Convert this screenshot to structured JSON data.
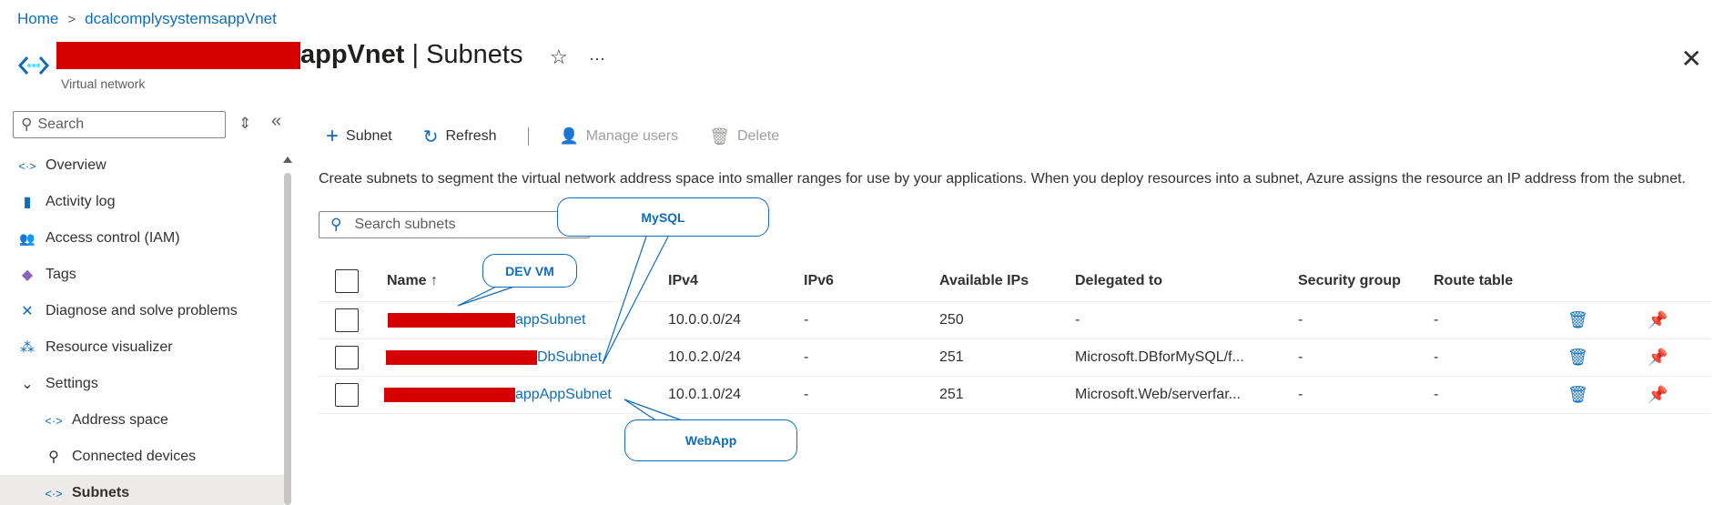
{
  "breadcrumb": {
    "home": "Home",
    "current": "dcalcomplysystemsappVnet",
    "sep": ">"
  },
  "header": {
    "title_name": "appVnet",
    "title_sep": " | ",
    "title_section": "Subnets",
    "subtitle": "Virtual network",
    "star": "☆",
    "more": "···",
    "close": "✕"
  },
  "sidebar": {
    "search_placeholder": "Search",
    "items": [
      {
        "label": "Overview",
        "icon": "<·>"
      },
      {
        "label": "Activity log",
        "icon": "▮"
      },
      {
        "label": "Access control (IAM)",
        "icon": "👥"
      },
      {
        "label": "Tags",
        "icon": "◆"
      },
      {
        "label": "Diagnose and solve problems",
        "icon": "✕"
      },
      {
        "label": "Resource visualizer",
        "icon": "⁂"
      },
      {
        "label": "Settings",
        "icon": "⌄"
      },
      {
        "label": "Address space",
        "icon": "<·>"
      },
      {
        "label": "Connected devices",
        "icon": "⚲"
      },
      {
        "label": "Subnets",
        "icon": "<·>"
      }
    ]
  },
  "toolbar": {
    "subnet": "Subnet",
    "refresh": "Refresh",
    "manage_users": "Manage users",
    "delete": "Delete"
  },
  "description": "Create subnets to segment the virtual network address space into smaller ranges for use by your applications. When you deploy resources into a subnet, Azure assigns the resource an IP address from the subnet.",
  "subnet_search_placeholder": "Search subnets",
  "table": {
    "columns": [
      "Name ↑",
      "IPv4",
      "IPv6",
      "Available IPs",
      "Delegated to",
      "Security group",
      "Route table"
    ],
    "rows": [
      {
        "name": "appSubnet",
        "ipv4": "10.0.0.0/24",
        "ipv6": "-",
        "available": "250",
        "delegated": "-",
        "nsg": "-",
        "route": "-"
      },
      {
        "name": "DbSubnet",
        "ipv4": "10.0.2.0/24",
        "ipv6": "-",
        "available": "251",
        "delegated": "Microsoft.DBforMySQL/f...",
        "nsg": "-",
        "route": "-"
      },
      {
        "name": "appAppSubnet",
        "ipv4": "10.0.1.0/24",
        "ipv6": "-",
        "available": "251",
        "delegated": "Microsoft.Web/serverfar...",
        "nsg": "-",
        "route": "-"
      }
    ]
  },
  "callouts": {
    "dev_vm": "DEV VM",
    "mysql": "MySQL",
    "webapp": "WebApp"
  },
  "colors": {
    "accent": "#0f6cbd",
    "redaction": "#d60000"
  }
}
